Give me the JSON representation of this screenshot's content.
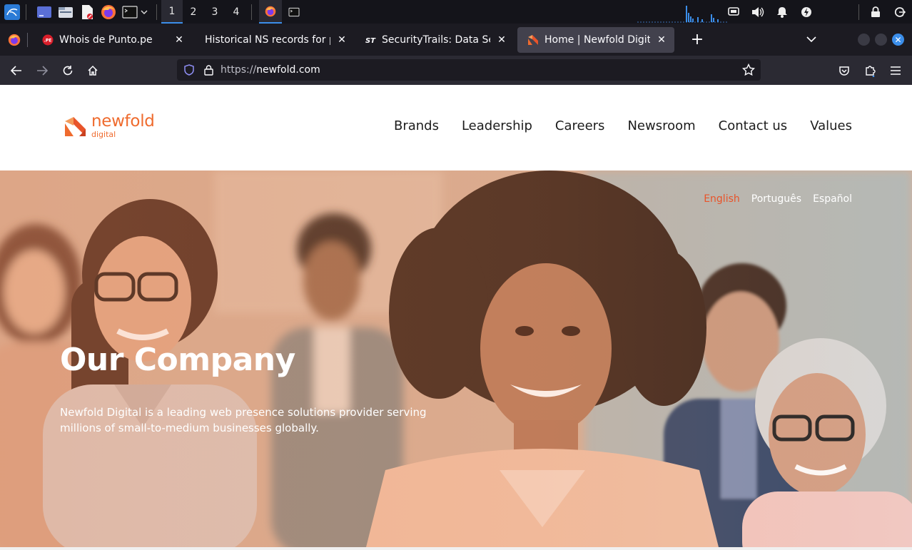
{
  "taskbar": {
    "workspaces": [
      "1",
      "2",
      "3",
      "4"
    ],
    "active_workspace": "1",
    "icons": [
      "kali-menu-icon",
      "desktop-icon",
      "file-manager-icon",
      "text-editor-icon",
      "firefox-icon",
      "terminal-icon"
    ],
    "tray": [
      "display-icon",
      "volume-icon",
      "bell-icon",
      "power-manager-icon",
      "lock-icon",
      "logout-icon"
    ]
  },
  "browser": {
    "tabs": [
      {
        "label": "Whois de Punto.pe",
        "favicon": "punto-pe-icon",
        "active": false
      },
      {
        "label": "Historical NS records for peru",
        "favicon": "none",
        "active": false
      },
      {
        "label": "SecurityTrails: Data Security",
        "favicon": "securitytrails-icon",
        "active": false
      },
      {
        "label": "Home | Newfold Digital",
        "favicon": "newfold-icon",
        "active": true
      }
    ],
    "url_protocol": "https://",
    "url_host": "newfold.com"
  },
  "site": {
    "logo_main": "newfold",
    "logo_sub": "digital",
    "nav": [
      "Brands",
      "Leadership",
      "Careers",
      "Newsroom",
      "Contact us",
      "Values"
    ],
    "languages": [
      "English",
      "Português",
      "Español"
    ],
    "active_language": "English",
    "hero_title": "Our Company",
    "hero_text": "Newfold Digital is a leading web presence solutions provider serving millions of small-to-medium businesses globally."
  },
  "colors": {
    "accent": "#ef6b2e",
    "active_lang": "#e8542a",
    "browser_bg": "#1c1b22",
    "focus_blue": "#3b8eea"
  }
}
